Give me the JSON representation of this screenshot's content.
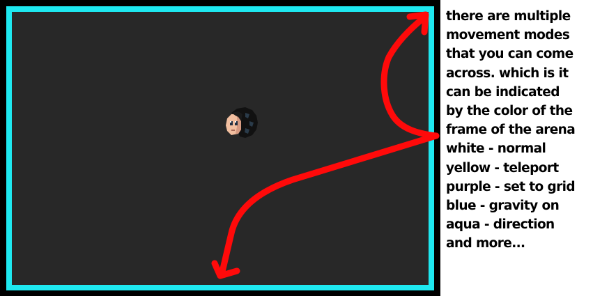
{
  "game": {
    "frame_color": "#1ee8f0",
    "arena_color": "#282828",
    "arrow_color": "#ff0a0a",
    "player": "player-head-sprite"
  },
  "caption": {
    "lines": [
      "there are multiple",
      "movement modes",
      "that you can come",
      "across. which is it",
      "can be indicated",
      "by the color of the",
      "frame of the arena",
      "white - normal",
      "yellow - teleport",
      "purple - set to grid",
      "blue - gravity on",
      "aqua - direction",
      "and more..."
    ]
  }
}
